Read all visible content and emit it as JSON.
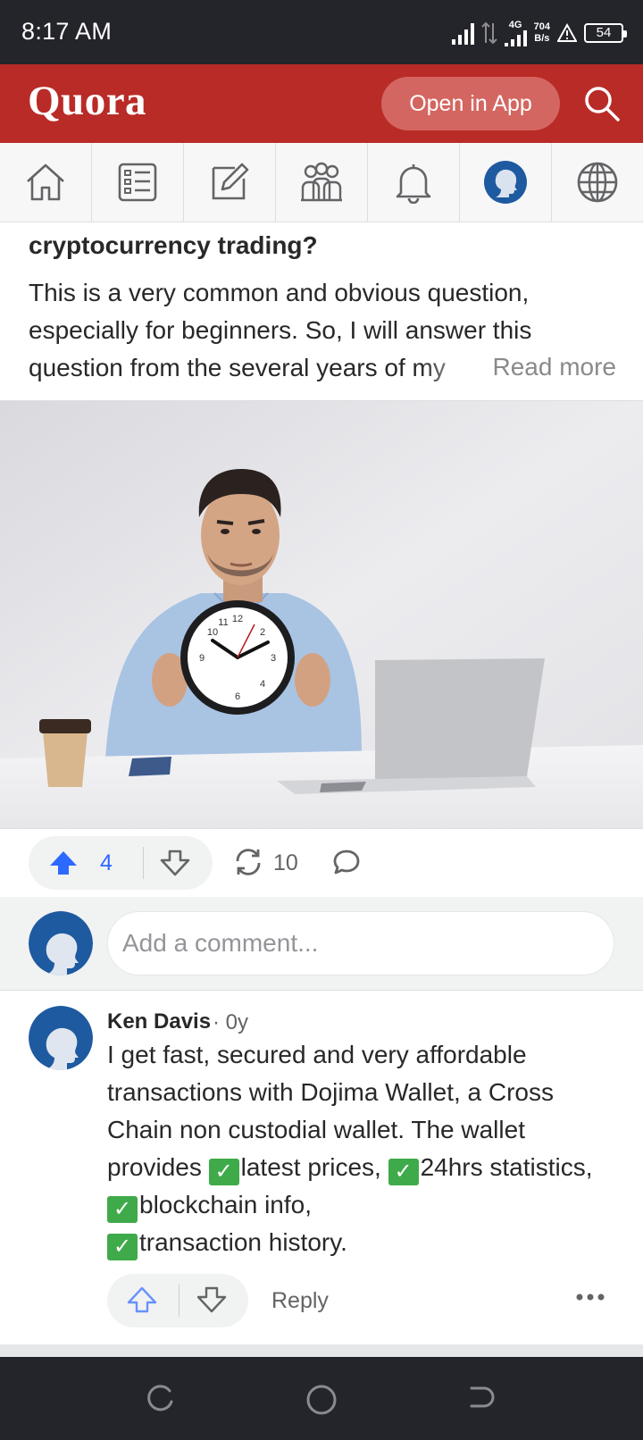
{
  "status_bar": {
    "time": "8:17 AM",
    "network_label": "4G",
    "speed_value": "704",
    "speed_unit": "B/s",
    "battery": "54"
  },
  "header": {
    "logo": "Quora",
    "open_in_app_label": "Open in App",
    "brand_color": "#b92b27"
  },
  "nav": {
    "items": [
      "home-icon",
      "following-icon",
      "answer-icon",
      "spaces-icon",
      "notifications-icon",
      "profile-icon",
      "languages-icon"
    ]
  },
  "answer": {
    "question_title_partial": "cryptocurrency trading?",
    "text": "This is a very common and obvious question, especially for beginners. So, I will answer this question from the several years of my",
    "read_more_label": "Read more"
  },
  "actions": {
    "upvotes": "4",
    "shares": "10"
  },
  "add_comment": {
    "placeholder": "Add a comment..."
  },
  "comment": {
    "author": "Ken Davis",
    "meta": "· 0y",
    "text_1": "I get fast, secured and very affordable transactions with Dojima Wallet, a Cross Chain non custodial wallet. The wallet provides ",
    "check_mark": "✓",
    "item_1": "latest prices, ",
    "item_2": "24hrs statistics, ",
    "item_3": "blockchain info, ",
    "item_4": "transaction history.",
    "reply_label": "Reply"
  }
}
